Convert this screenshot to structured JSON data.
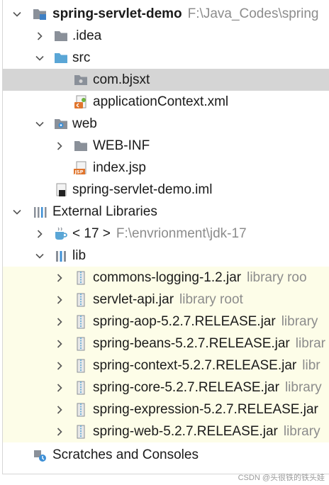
{
  "project": {
    "name": "spring-servlet-demo",
    "path": "F:\\Java_Codes\\spring"
  },
  "tree": {
    "idea": ".idea",
    "src": "src",
    "package": "com.bjsxt",
    "app_context": "applicationContext.xml",
    "web": "web",
    "web_inf": "WEB-INF",
    "index_jsp": "index.jsp",
    "iml": "spring-servlet-demo.iml",
    "external_libraries": "External Libraries",
    "jdk": {
      "name": "< 17 >",
      "path": "F:\\envrionment\\jdk-17"
    },
    "lib": "lib",
    "library_hint": "library root",
    "jars": [
      {
        "name": "commons-logging-1.2.jar",
        "hint": "library roo"
      },
      {
        "name": "servlet-api.jar",
        "hint": "library root"
      },
      {
        "name": "spring-aop-5.2.7.RELEASE.jar",
        "hint": "library"
      },
      {
        "name": "spring-beans-5.2.7.RELEASE.jar",
        "hint": "librar"
      },
      {
        "name": "spring-context-5.2.7.RELEASE.jar",
        "hint": "libr"
      },
      {
        "name": "spring-core-5.2.7.RELEASE.jar",
        "hint": "library"
      },
      {
        "name": "spring-expression-5.2.7.RELEASE.jar",
        "hint": ""
      },
      {
        "name": "spring-web-5.2.7.RELEASE.jar",
        "hint": "library"
      }
    ],
    "scratches": "Scratches and Consoles"
  },
  "watermark": "CSDN @头很铁的铁头娃",
  "colors": {
    "selection": "#d5d5d5",
    "library_background": "#fdfde8",
    "folder": "#8a9099",
    "source_folder": "#5aa6d6",
    "hint_text": "#8c8c8c"
  }
}
